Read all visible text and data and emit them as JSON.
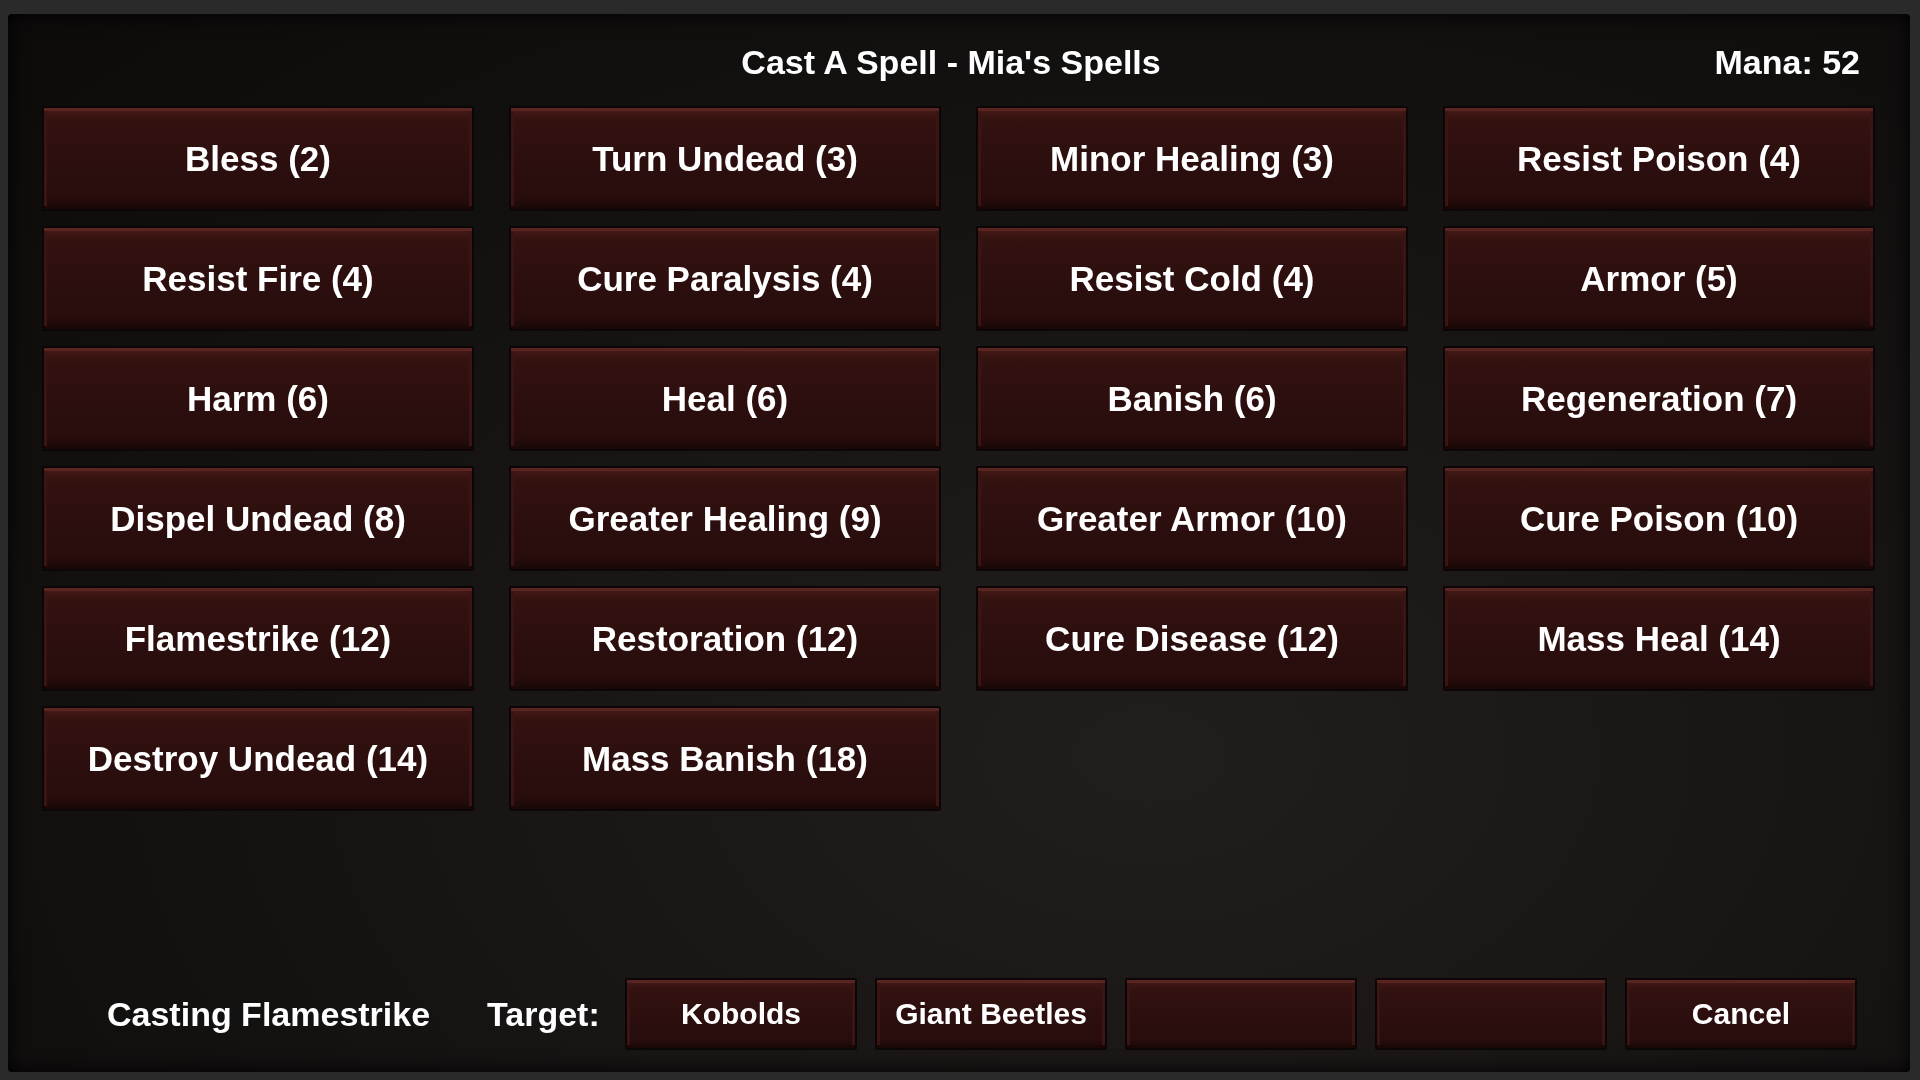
{
  "title": "Cast A Spell - Mia's Spells",
  "mana": "Mana: 52",
  "spells": [
    {
      "label": "Bless (2)"
    },
    {
      "label": "Turn Undead (3)"
    },
    {
      "label": "Minor Healing (3)"
    },
    {
      "label": "Resist Poison (4)"
    },
    {
      "label": "Resist Fire (4)"
    },
    {
      "label": "Cure Paralysis (4)"
    },
    {
      "label": "Resist Cold (4)"
    },
    {
      "label": "Armor (5)"
    },
    {
      "label": "Harm (6)"
    },
    {
      "label": "Heal (6)"
    },
    {
      "label": "Banish (6)"
    },
    {
      "label": "Regeneration (7)"
    },
    {
      "label": "Dispel Undead (8)"
    },
    {
      "label": "Greater Healing (9)"
    },
    {
      "label": "Greater Armor (10)"
    },
    {
      "label": "Cure Poison (10)"
    },
    {
      "label": "Flamestrike (12)"
    },
    {
      "label": "Restoration (12)"
    },
    {
      "label": "Cure Disease (12)"
    },
    {
      "label": "Mass Heal (14)"
    },
    {
      "label": "Destroy Undead (14)"
    },
    {
      "label": "Mass Banish (18)"
    }
  ],
  "status": "Casting Flamestrike",
  "target_label": "Target:",
  "targets": [
    {
      "kind": "target",
      "label": "Kobolds"
    },
    {
      "kind": "target",
      "label": "Giant Beetles"
    },
    {
      "kind": "empty"
    },
    {
      "kind": "empty"
    }
  ],
  "cancel": "Cancel"
}
